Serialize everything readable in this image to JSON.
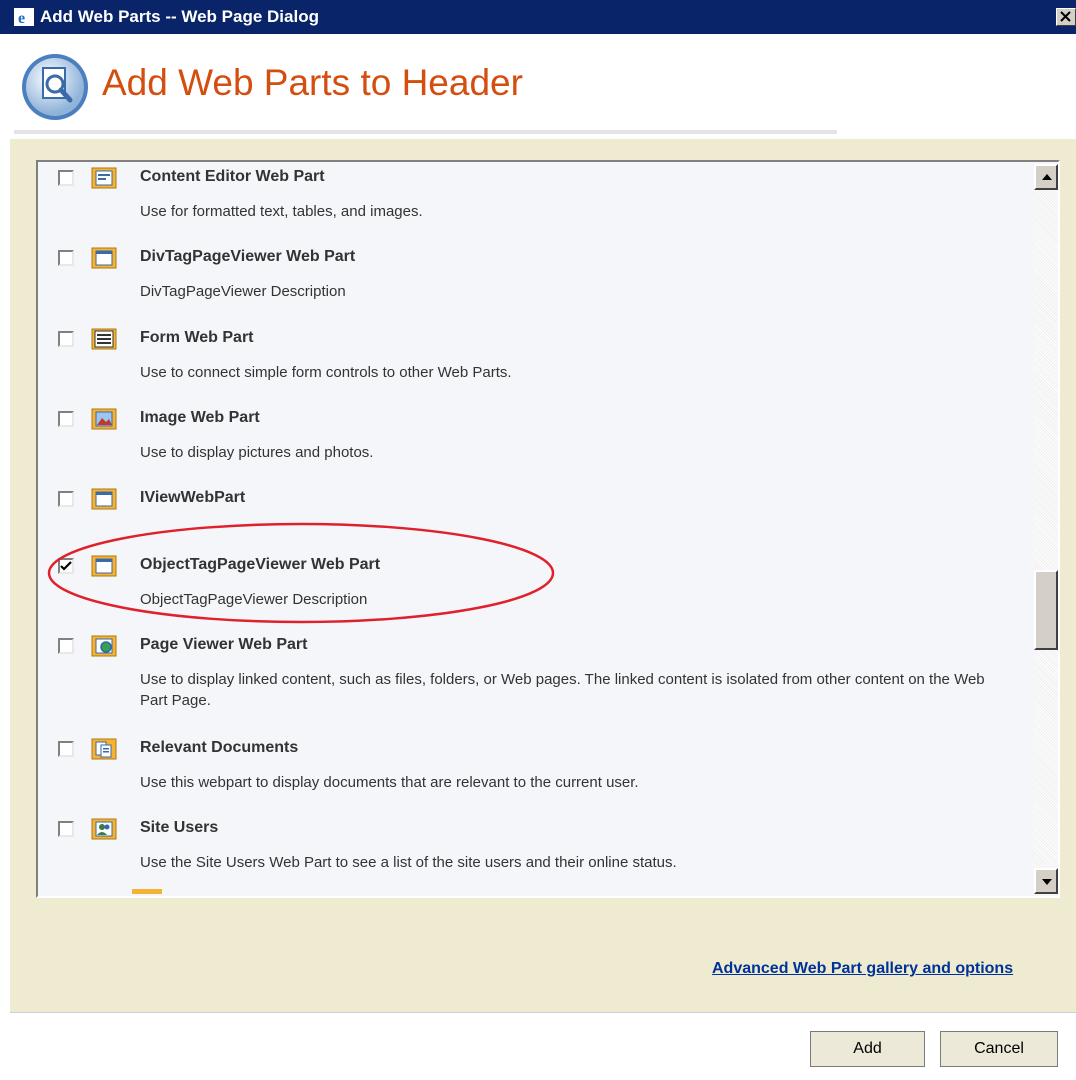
{
  "window": {
    "title": "Add Web Parts -- Web Page Dialog"
  },
  "header": {
    "title": "Add Web Parts to Header"
  },
  "web_parts": [
    {
      "name": "Content Editor Web Part",
      "description": "Use for formatted text, tables, and images.",
      "checked": false,
      "icon": "content-editor-icon"
    },
    {
      "name": "DivTagPageViewer Web Part",
      "description": "DivTagPageViewer Description",
      "checked": false,
      "icon": "web-part-window-icon"
    },
    {
      "name": "Form Web Part",
      "description": "Use to connect simple form controls to other Web Parts.",
      "checked": false,
      "icon": "form-icon"
    },
    {
      "name": "Image Web Part",
      "description": "Use to display pictures and photos.",
      "checked": false,
      "icon": "image-icon"
    },
    {
      "name": "IViewWebPart",
      "description": "",
      "checked": false,
      "icon": "web-part-window-icon"
    },
    {
      "name": "ObjectTagPageViewer Web Part",
      "description": "ObjectTagPageViewer Description",
      "checked": true,
      "icon": "web-part-window-icon"
    },
    {
      "name": "Page Viewer Web Part",
      "description": "Use to display linked content, such as files, folders, or Web pages. The linked content is isolated from other content on the Web Part Page.",
      "checked": false,
      "icon": "page-viewer-icon"
    },
    {
      "name": "Relevant Documents",
      "description": "Use this webpart to display documents that are relevant to the current user.",
      "checked": false,
      "icon": "documents-icon"
    },
    {
      "name": "Site Users",
      "description": "Use the Site Users Web Part to see a list of the site users and their online status.",
      "checked": false,
      "icon": "site-users-icon"
    }
  ],
  "links": {
    "advanced": "Advanced Web Part gallery and options"
  },
  "buttons": {
    "add": "Add",
    "cancel": "Cancel"
  },
  "colors": {
    "title_bar": "#0a246a",
    "heading": "#d34e0f",
    "panel_background": "#efebd0",
    "link": "#003399",
    "annotation": "#e0202a"
  }
}
